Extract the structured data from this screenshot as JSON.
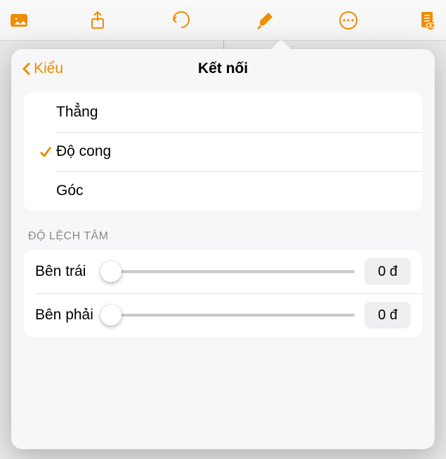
{
  "toolbar": {
    "icons": [
      "photos-icon",
      "share-icon",
      "undo-icon",
      "format-brush-icon",
      "more-icon",
      "document-settings-icon"
    ]
  },
  "popover": {
    "backLabel": "Kiểu",
    "title": "Kết nối",
    "options": [
      {
        "label": "Thẳng",
        "selected": false
      },
      {
        "label": "Độ cong",
        "selected": true
      },
      {
        "label": "Góc",
        "selected": false
      }
    ],
    "sectionTitle": "ĐỘ LỆCH TÂM",
    "sliders": [
      {
        "label": "Bên trái",
        "value": "0 đ"
      },
      {
        "label": "Bên phải",
        "value": "0 đ"
      }
    ]
  }
}
